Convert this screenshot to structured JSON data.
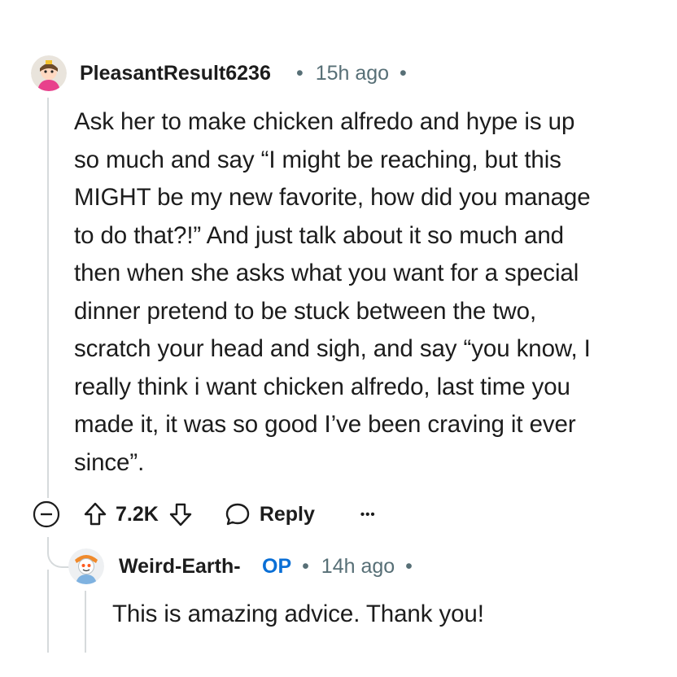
{
  "comments": [
    {
      "author": "PleasantResult6236",
      "separator": "•",
      "time": "15h ago",
      "avatar": "snoo-avatar-icon",
      "body": "Ask her to make chicken alfredo and hype is up\nso much and say “I might be reaching, but this\nMIGHT be my new favorite, how did you manage\nto do that?!” And just talk about it so much and\nthen when she asks what you want for a special\ndinner pretend to be stuck between the two,\nscratch your head and sigh, and say “you know, I\nreally think i want chicken alfredo, last time you\nmade it, it was so good I’ve been craving it ever\nsince”.",
      "actions": {
        "collapse_icon": "minus-circle-icon",
        "upvote_icon": "upvote-arrow-icon",
        "score": "7.2K",
        "downvote_icon": "downvote-arrow-icon",
        "reply_icon": "speech-bubble-icon",
        "reply_label": "Reply",
        "more_label": "•••"
      }
    },
    {
      "author": "Weird-Earth-",
      "op_badge": "OP",
      "separator": "•",
      "time": "14h ago",
      "avatar": "snoo-avatar-icon",
      "body": "This is amazing advice. Thank you!"
    }
  ],
  "colors": {
    "text": "#1c1c1c",
    "meta": "#576f76",
    "op": "#0a6fd6",
    "thread_line": "#d6dadc"
  }
}
